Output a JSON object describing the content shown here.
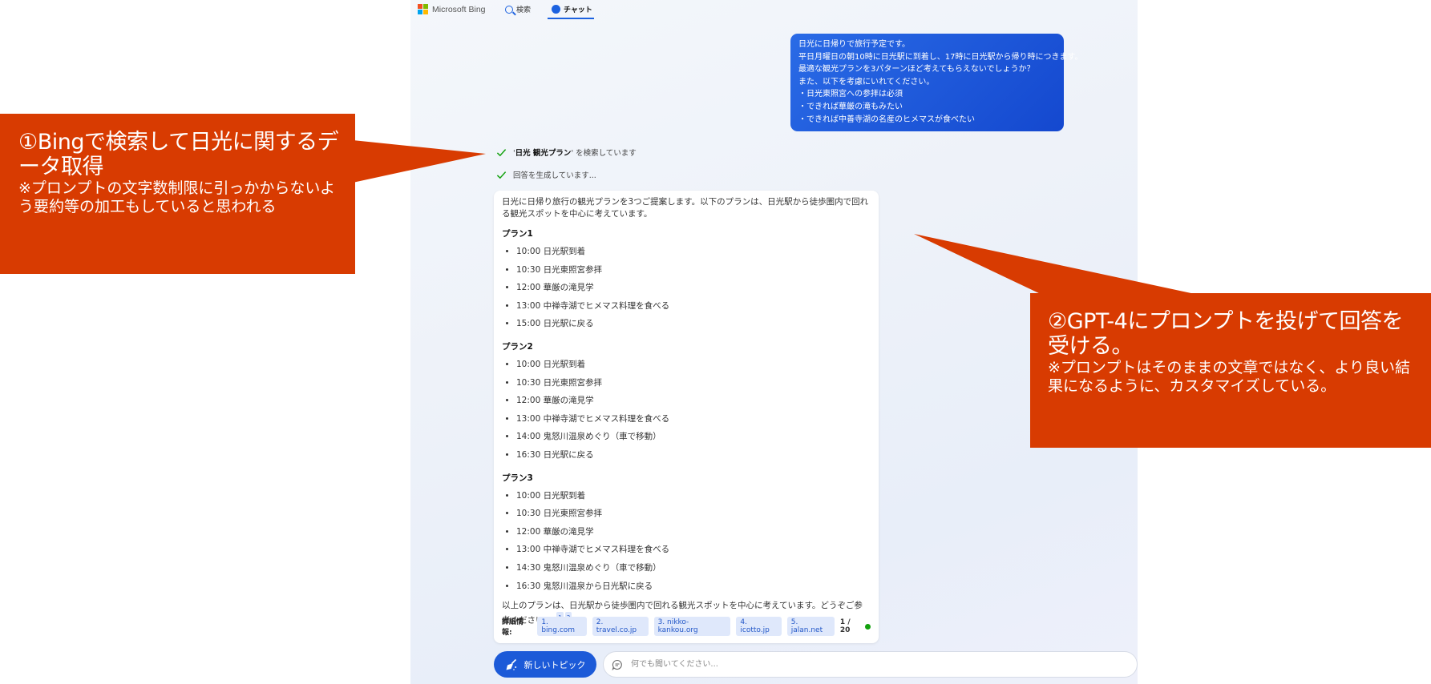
{
  "header": {
    "logo_text": "Microsoft Bing",
    "search_label": "検索",
    "chat_label": "チャット"
  },
  "user_message": {
    "lines": [
      "日光に日帰りで旅行予定です。",
      "平日月曜日の朝10時に日光駅に到着し、17時に日光駅から帰り時につきます。",
      "最適な観光プランを3パターンほど考えてもらえないでしょうか？",
      "また、以下を考慮にいれてください。",
      "・日光東照宮への参拝は必須",
      "・できれば華厳の滝もみたい",
      "・できれば中善寺湖の名産のヒメマスが食べたい"
    ]
  },
  "status": {
    "searching_quote_open": "'",
    "searching_term": "日光 観光プラン",
    "searching_quote_close": "'",
    "searching_suffix": " を検索しています",
    "generating": "回答を生成しています..."
  },
  "answer": {
    "intro": "日光に日帰り旅行の観光プランを3つご提案します。以下のプランは、日光駅から徒歩圏内で回れる観光スポットを中心に考えています。",
    "plans": [
      {
        "title": "プラン1",
        "items": [
          "10:00 日光駅到着",
          "10:30 日光東照宮参拝",
          "12:00 華厳の滝見学",
          "13:00 中禅寺湖でヒメマス料理を食べる",
          "15:00 日光駅に戻る"
        ]
      },
      {
        "title": "プラン2",
        "items": [
          "10:00 日光駅到着",
          "10:30 日光東照宮参拝",
          "12:00 華厳の滝見学",
          "13:00 中禅寺湖でヒメマス料理を食べる",
          "14:00 鬼怒川温泉めぐり（車で移動）",
          "16:30 日光駅に戻る"
        ]
      },
      {
        "title": "プラン3",
        "items": [
          "10:00 日光駅到着",
          "10:30 日光東照宮参拝",
          "12:00 華厳の滝見学",
          "13:00 中禅寺湖でヒメマス料理を食べる",
          "14:30 鬼怒川温泉めぐり（車で移動）",
          "16:30 鬼怒川温泉から日光駅に戻る"
        ]
      }
    ],
    "outro": "以上のプランは、日光駅から徒歩圏内で回れる観光スポットを中心に考えています。どうぞご参考ください。",
    "ref_marks": [
      "1",
      "2"
    ],
    "details_label": "詳細情報:",
    "sources": [
      "1. bing.com",
      "2. travel.co.jp",
      "3. nikko-kankou.org",
      "4. icotto.jp",
      "5. jalan.net"
    ],
    "pager": "1 / 20"
  },
  "composer": {
    "new_topic_label": "新しいトピック",
    "placeholder": "何でも聞いてください..."
  },
  "callouts": {
    "first": {
      "title": "①Bingで検索して日光に関するデータ取得",
      "note": "※プロンプトの文字数制限に引っかからないよう要約等の加工もしていると思われる"
    },
    "second": {
      "title": "②GPT-4にプロンプトを投げて回答を受ける。",
      "note": "※プロンプトはそのままの文章ではなく、より良い結果になるように、カスタマイズしている。"
    }
  },
  "colors": {
    "callout_bg": "#d83b01",
    "accent": "#1c5ad8",
    "user_bubble": "#1f5ddc"
  }
}
